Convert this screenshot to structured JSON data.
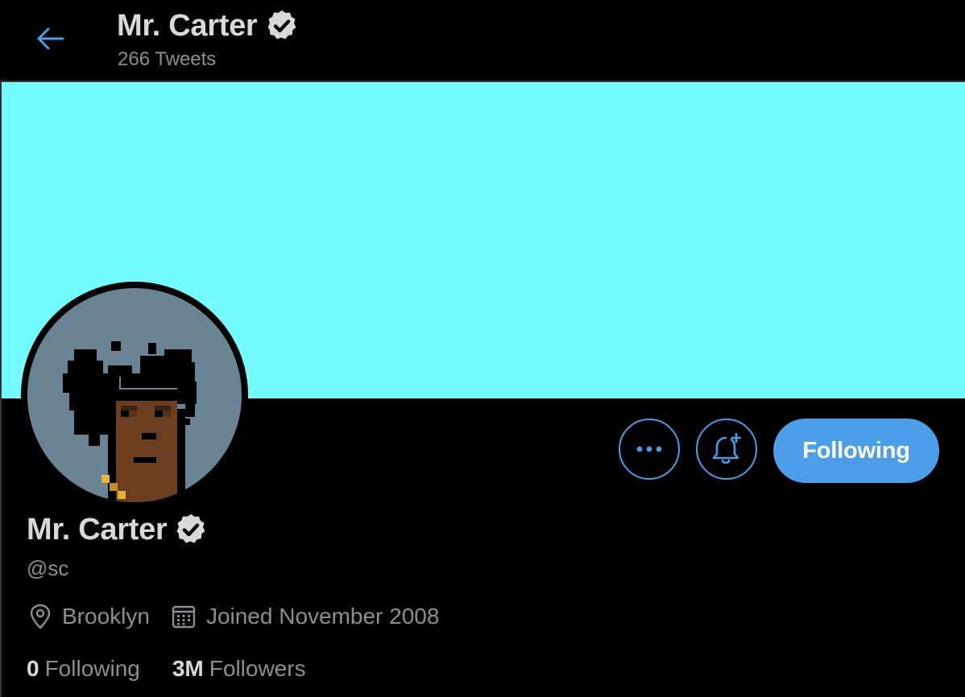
{
  "header": {
    "back_icon": "arrow-left-icon",
    "name": "Mr. Carter",
    "verified_icon": "verified-badge-icon",
    "tweet_count": "266 Tweets"
  },
  "banner": {
    "color": "#75fdfe"
  },
  "avatar": {
    "description_icon": "pixel-avatar-icon",
    "background": "#6b8493"
  },
  "actions": {
    "more_icon": "more-dots-icon",
    "notify_icon": "bell-plus-icon",
    "following_label": "Following"
  },
  "profile": {
    "name": "Mr. Carter",
    "verified_icon": "verified-badge-icon",
    "handle": "@sc",
    "location_icon": "location-pin-icon",
    "location": "Brooklyn",
    "joined_icon": "calendar-icon",
    "joined": "Joined November 2008"
  },
  "stats": {
    "following_count": "0",
    "following_label": "Following",
    "followers_count": "3M",
    "followers_label": "Followers"
  },
  "colors": {
    "accent": "#4c9ee8",
    "background": "#000000",
    "primary_text": "#d9d9d9",
    "secondary_text": "#8b8f94"
  }
}
